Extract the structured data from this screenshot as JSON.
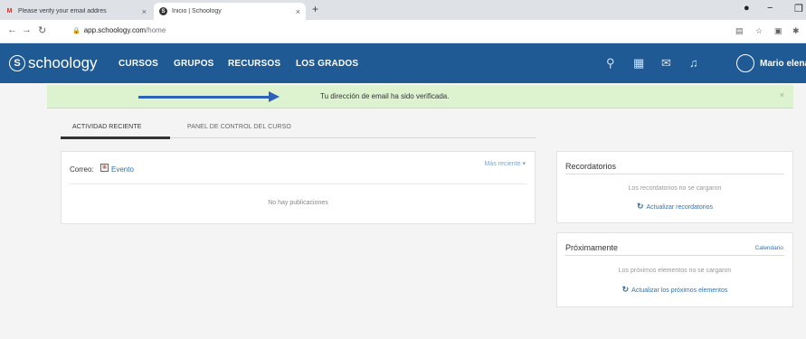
{
  "browser": {
    "tabs": [
      {
        "title": "Please verify your email addres",
        "favicon": "gmail-icon"
      },
      {
        "title": "Inicio | Schoology",
        "favicon": "schoology-favicon"
      }
    ],
    "new_tab": "+",
    "url_host": "app.schoology.com",
    "url_path": "/home"
  },
  "nav": {
    "logo": "schoology",
    "links": [
      "CURSOS",
      "GRUPOS",
      "RECURSOS",
      "LOS GRADOS"
    ],
    "user_name": "Mario elena"
  },
  "banner": {
    "message": "Tu dirección de email ha sido verificada.",
    "close": "×"
  },
  "subtabs": {
    "items": [
      "ACTIVIDAD RECIENTE",
      "PANEL DE CONTROL DEL CURSO"
    ],
    "active": 0
  },
  "feed": {
    "post_label": "Correo:",
    "event_label": "Evento",
    "sort_label": "Más reciente ▾",
    "empty_text": "No hay publicaciones"
  },
  "reminders": {
    "title": "Recordatorios",
    "note": "Los recordatorios no se cargaron",
    "action": "Actualizar recordatorios"
  },
  "upcoming": {
    "title": "Próximamente",
    "calendar_link": "Calendario",
    "note": "Los próximos elementos no se cargaron",
    "action": "Actualizar los próximos elementos"
  },
  "colors": {
    "nav_bg": "#1f5a94",
    "banner_bg": "#ddf2cf",
    "link": "#2d73b9",
    "arrow": "#2e62b8"
  }
}
